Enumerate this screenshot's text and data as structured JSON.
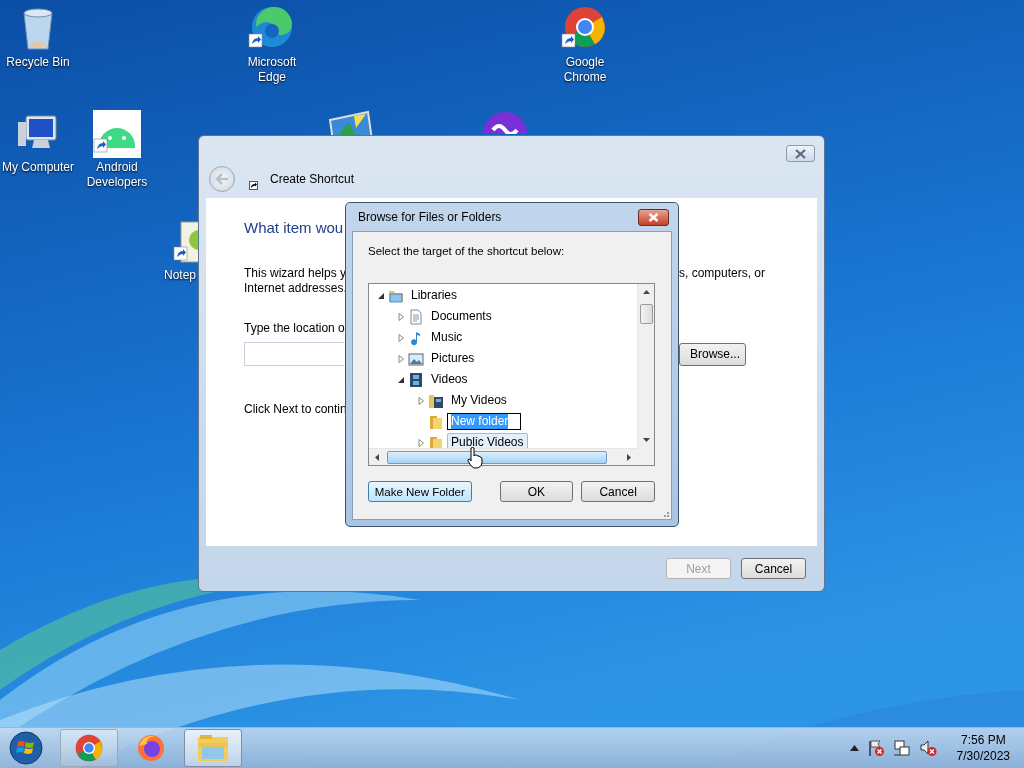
{
  "desktop_icons": [
    {
      "label": "Recycle Bin",
      "kind": "recycle-bin",
      "shortcut": false
    },
    {
      "label": "Microsoft Edge",
      "kind": "edge",
      "shortcut": true
    },
    {
      "label": "Google Chrome",
      "kind": "chrome",
      "shortcut": true
    },
    {
      "label": "My Computer",
      "kind": "computer",
      "shortcut": false
    },
    {
      "label": "Android Developers",
      "kind": "android",
      "shortcut": true
    },
    {
      "label": "Notep",
      "kind": "notepad",
      "shortcut": true
    },
    {
      "kind": "image"
    },
    {
      "kind": "purple"
    }
  ],
  "wizard": {
    "title": "Create Shortcut",
    "heading": "What item wou",
    "intro_left": "This wizard helps y",
    "intro_right": "s, computers, or",
    "intro_line2": "Internet addresses.",
    "location_label": "Type the location o",
    "browse_button": "Browse...",
    "continue_text": "Click Next to contin",
    "buttons": [
      {
        "label": "Next",
        "disabled": true
      },
      {
        "label": "Cancel",
        "disabled": false
      }
    ]
  },
  "browse_dialog": {
    "title": "Browse for Files or Folders",
    "instruction": "Select the target of the shortcut below:",
    "tree": [
      {
        "label": "Libraries",
        "kind": "library",
        "expanded": true,
        "editing": false,
        "hovered": false,
        "children": [
          {
            "label": "Documents",
            "kind": "document",
            "expanded": false,
            "editing": false,
            "hovered": false
          },
          {
            "label": "Music",
            "kind": "music",
            "expanded": false,
            "editing": false,
            "hovered": false
          },
          {
            "label": "Pictures",
            "kind": "pictures",
            "expanded": false,
            "editing": false,
            "hovered": false
          },
          {
            "label": "Videos",
            "kind": "videos",
            "expanded": true,
            "editing": false,
            "hovered": false,
            "children": [
              {
                "label": "My Videos",
                "kind": "video-folder",
                "expanded": false,
                "editing": false,
                "hovered": false
              },
              {
                "label": "New folder",
                "kind": "folder",
                "editing": true
              },
              {
                "label": "Public Videos",
                "kind": "folder",
                "expanded": false,
                "editing": false,
                "hovered": true
              }
            ]
          }
        ]
      }
    ],
    "buttons": [
      {
        "label": "Make New Folder",
        "highlighted": true
      },
      {
        "label": "OK",
        "highlighted": false
      },
      {
        "label": "Cancel",
        "highlighted": false
      }
    ]
  },
  "taskbar": {
    "apps": [
      {
        "kind": "chrome",
        "active": false
      },
      {
        "kind": "firefox",
        "active": false
      },
      {
        "kind": "explorer",
        "active": true
      }
    ],
    "clock_time": "7:56 PM",
    "clock_date": "7/30/2023"
  }
}
